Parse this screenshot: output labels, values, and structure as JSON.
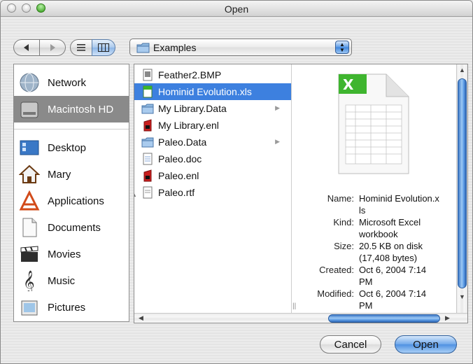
{
  "window": {
    "title": "Open"
  },
  "toolbar": {
    "location": "Examples"
  },
  "sidebar": {
    "items": [
      {
        "label": "Network",
        "icon": "network-globe-icon"
      },
      {
        "label": "Macintosh HD",
        "icon": "hard-drive-icon",
        "selected": true
      },
      {
        "label": "Desktop",
        "icon": "desktop-icon"
      },
      {
        "label": "Mary",
        "icon": "home-icon"
      },
      {
        "label": "Applications",
        "icon": "applications-icon"
      },
      {
        "label": "Documents",
        "icon": "documents-icon"
      },
      {
        "label": "Movies",
        "icon": "movies-clapper-icon"
      },
      {
        "label": "Music",
        "icon": "music-note-icon"
      },
      {
        "label": "Pictures",
        "icon": "pictures-icon"
      }
    ]
  },
  "files": [
    {
      "name": "Feather2.BMP",
      "icon": "bmp-file-icon"
    },
    {
      "name": "Hominid Evolution.xls",
      "icon": "excel-file-icon",
      "selected": true
    },
    {
      "name": "My Library.Data",
      "icon": "folder-icon",
      "folder": true
    },
    {
      "name": "My Library.enl",
      "icon": "endnote-file-icon"
    },
    {
      "name": "Paleo.Data",
      "icon": "folder-icon",
      "folder": true
    },
    {
      "name": "Paleo.doc",
      "icon": "doc-file-icon"
    },
    {
      "name": "Paleo.enl",
      "icon": "endnote-file-icon"
    },
    {
      "name": "Paleo.rtf",
      "icon": "rtf-file-icon"
    }
  ],
  "preview": {
    "icon": "excel-spreadsheet-icon",
    "name_key": "Name:",
    "name_value": "Hominid Evolution.x ls",
    "kind_key": "Kind:",
    "kind_value": "Microsoft Excel workbook",
    "size_key": "Size:",
    "size_value": "20.5 KB on disk (17,408 bytes)",
    "created_key": "Created:",
    "created_value": "Oct 6, 2004 7:14 PM",
    "modified_key": "Modified:",
    "modified_value": "Oct 6, 2004 7:14 PM"
  },
  "buttons": {
    "cancel": "Cancel",
    "open": "Open"
  },
  "colors": {
    "selection": "#3d80df",
    "sidebar_selected": "#8a8a8a",
    "default_button": "#5b9be6"
  }
}
